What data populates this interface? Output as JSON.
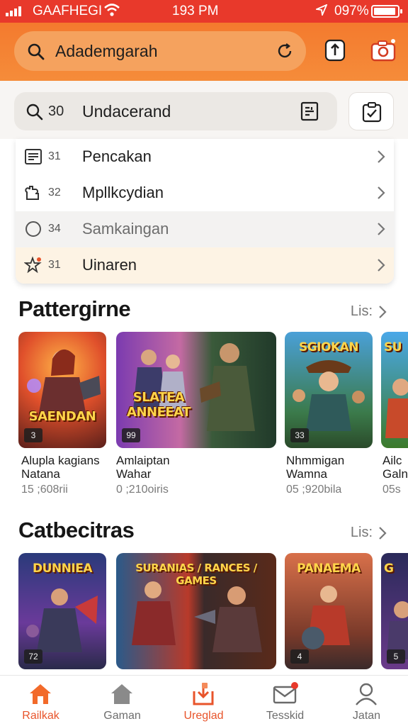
{
  "status_bar": {
    "carrier": "GAAFHEGI",
    "time": "193 PM",
    "battery": "097%"
  },
  "header": {
    "search_text": "Adademgarah",
    "icons": [
      "search-icon",
      "refresh-icon",
      "share-icon",
      "camera-icon"
    ]
  },
  "search_bar": {
    "prefix": "30",
    "text": "Undacerand",
    "icons": [
      "search-icon",
      "scan-icon",
      "checklist-icon"
    ]
  },
  "suggestions": [
    {
      "num": "31",
      "label": "Pencakan",
      "icon": "list-icon"
    },
    {
      "num": "32",
      "label": "Mpllkcydian",
      "icon": "puzzle-icon"
    },
    {
      "num": "34",
      "label": "Samkaingan",
      "icon": "circle-icon"
    },
    {
      "num": "31",
      "label": "Uinaren",
      "icon": "star-icon"
    }
  ],
  "sections": [
    {
      "title": "Pattergirne",
      "see_all": "Lis:",
      "cards": [
        {
          "art_text": "SAENDAN",
          "badge": "3",
          "title": "Alupla kagians\nNatana",
          "sub": "15 ;608rii"
        },
        {
          "art_text": "SLATEA ANNEEAT",
          "badge": "99",
          "title": "Amlaiptan\nWahar",
          "sub": "0 ;210oiris"
        },
        {
          "art_text": "SGIOKAN",
          "badge": "33",
          "title": "Nhmmigan\nWamna",
          "sub": "05 ;920bila"
        },
        {
          "art_text": "SU",
          "badge": "",
          "title": "Ailc\nGaln",
          "sub": "05s"
        }
      ]
    },
    {
      "title": "Catbecitras",
      "see_all": "Lis:",
      "cards": [
        {
          "art_text": "DUNNIEA",
          "badge": "72",
          "title": "",
          "sub": ""
        },
        {
          "art_text": "SURANIAS / RANCES / GAMES",
          "badge": "",
          "title": "",
          "sub": ""
        },
        {
          "art_text": "PANAEMA",
          "badge": "4",
          "title": "",
          "sub": ""
        },
        {
          "art_text": "G",
          "badge": "5",
          "title": "",
          "sub": ""
        }
      ]
    }
  ],
  "bottom_nav": [
    {
      "label": "Railkak",
      "icon": "home-icon",
      "active": true
    },
    {
      "label": "Gaman",
      "icon": "house-icon",
      "active": false
    },
    {
      "label": "Ureglad",
      "icon": "download-icon",
      "active": false
    },
    {
      "label": "Tesskid",
      "icon": "mail-icon",
      "active": false
    },
    {
      "label": "Jatan",
      "icon": "profile-icon",
      "active": false
    }
  ],
  "colors": {
    "accent": "#f47a2e",
    "status": "#e8392b",
    "nav_active": "#e8542b"
  }
}
